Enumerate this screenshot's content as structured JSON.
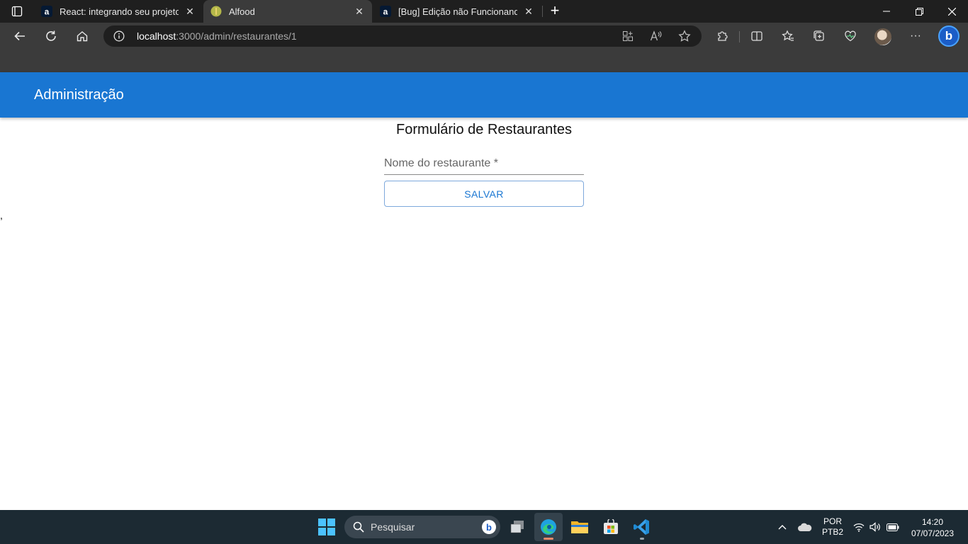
{
  "browser": {
    "tabs": [
      {
        "title": "React: integrando seu projeto Re",
        "icon": "alura-icon"
      },
      {
        "title": "Alfood",
        "icon": "alfood-icon",
        "active": true
      },
      {
        "title": "[Bug] Edição não Funcionando | ",
        "icon": "alura-icon"
      }
    ],
    "address": {
      "host": "localhost",
      "path": ":3000/admin/restaurantes/1"
    }
  },
  "app": {
    "appbar_title": "Administração",
    "form_title": "Formulário de Restaurantes",
    "name_field": {
      "label": "Nome do restaurante *",
      "value": ""
    },
    "save_label": "SALVAR",
    "stray_text": ","
  },
  "taskbar": {
    "search_placeholder": "Pesquisar",
    "lang_top": "POR",
    "lang_bottom": "PTB2",
    "time": "14:20",
    "date": "07/07/2023"
  },
  "colors": {
    "appbar": "#1976d2",
    "accent": "#1976d2"
  }
}
